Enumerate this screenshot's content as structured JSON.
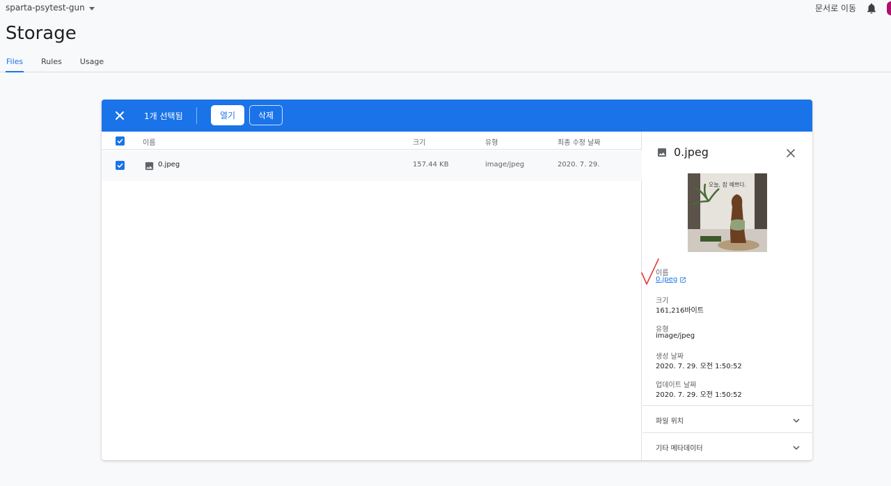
{
  "header": {
    "project": "sparta-psytest-gun",
    "docs_link": "문서로 이동",
    "page_title": "Storage",
    "tabs": [
      {
        "label": "Files",
        "active": true
      },
      {
        "label": "Rules",
        "active": false
      },
      {
        "label": "Usage",
        "active": false
      }
    ]
  },
  "selection_bar": {
    "count_label": "1개 선택됨",
    "open_label": "열기",
    "delete_label": "삭제"
  },
  "table": {
    "columns": {
      "name": "이름",
      "size": "크기",
      "type": "유형",
      "modified": "최종 수정 날짜"
    },
    "rows": [
      {
        "name": "0.jpeg",
        "size": "157.44 KB",
        "type": "image/jpeg",
        "modified": "2020. 7. 29."
      }
    ]
  },
  "detail": {
    "title": "0.jpeg",
    "name_label": "이름",
    "name_value": "0.jpeg",
    "size_label": "크기",
    "size_value": "161,216바이트",
    "type_label": "유형",
    "type_value": "image/jpeg",
    "created_label": "생성 날짜",
    "created_value": "2020. 7. 29. 오전 1:50:52",
    "updated_label": "업데이트 날짜",
    "updated_value": "2020. 7. 29. 오전 1:50:52",
    "file_location_label": "파일 위치",
    "other_metadata_label": "기타 메타데이터",
    "thumbnail_caption": "오늘, 참 예쁘다."
  },
  "colors": {
    "accent": "#1a73e8",
    "annotation": "#e53935"
  }
}
